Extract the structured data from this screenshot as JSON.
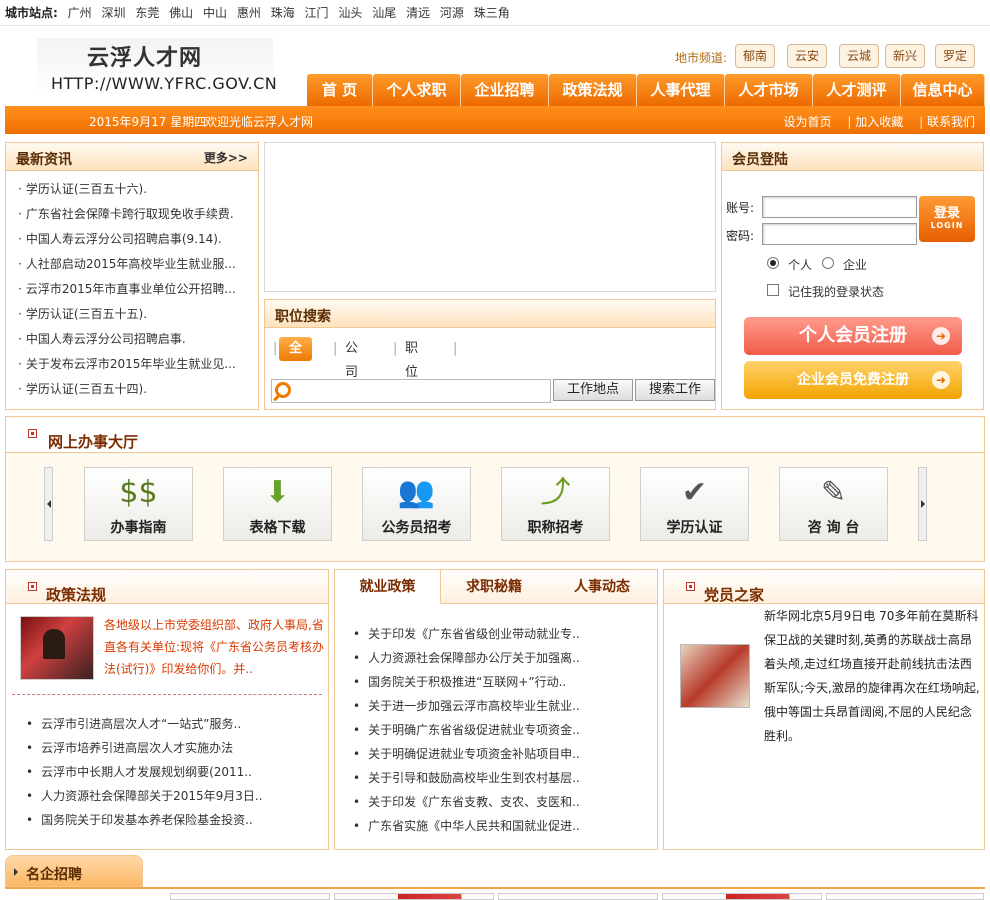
{
  "city_sites": {
    "label": "城市站点:",
    "cities": [
      "广州",
      "深圳",
      "东莞",
      "佛山",
      "中山",
      "惠州",
      "珠海",
      "江门",
      "汕头",
      "汕尾",
      "清远",
      "河源",
      "珠三角"
    ]
  },
  "logo": {
    "name": "云浮人才网",
    "url": "HTTP://WWW.YFRC.GOV.CN"
  },
  "channels": {
    "label": "地市频道:",
    "items": [
      "郁南",
      "云安",
      "云城",
      "新兴",
      "罗定"
    ]
  },
  "nav": [
    "首 页",
    "个人求职",
    "企业招聘",
    "政策法规",
    "人事代理",
    "人才市场",
    "人才测评",
    "信息中心"
  ],
  "welcome_bar": {
    "date": "2015年9月17 星期四",
    "welcome": "欢迎光临云浮人才网",
    "links": [
      "设为首页",
      "加入收藏",
      "联系我们"
    ]
  },
  "news": {
    "title": "最新资讯",
    "more": "更多>>",
    "items": [
      "学历认证(三百五十六).",
      "广东省社会保障卡跨行取现免收手续费.",
      "中国人寿云浮分公司招聘启事(9.14).",
      "人社部启动2015年高校毕业生就业服...",
      "云浮市2015年市直事业单位公开招聘...",
      "学历认证(三百五十五).",
      "中国人寿云浮分公司招聘启事.",
      "关于发布云浮市2015年毕业生就业见...",
      "学历认证(三百五十四)."
    ]
  },
  "job_search": {
    "title": "职位搜索",
    "tabs": [
      "全文",
      "公司名",
      "职位名"
    ],
    "input_value": "",
    "btn_location": "工作地点",
    "btn_search": "搜索工作"
  },
  "login": {
    "title": "会员登陆",
    "account_label": "账号:",
    "password_label": "密码:",
    "login_btn": "登录",
    "login_btn_en": "LOGIN",
    "radio_personal": "个人",
    "radio_company": "企业",
    "remember": "记住我的登录状态",
    "reg_personal": "个人会员注册",
    "reg_company": "企业会员免费注册"
  },
  "hall": {
    "title": "网上办事大厅",
    "tiles": [
      {
        "label": "办事指南",
        "icon": "money-bags-icon"
      },
      {
        "label": "表格下载",
        "icon": "download-icon"
      },
      {
        "label": "公务员招考",
        "icon": "people-icon"
      },
      {
        "label": "职称招考",
        "icon": "climb-icon"
      },
      {
        "label": "学历认证",
        "icon": "certificate-icon"
      },
      {
        "label": "咨 询 台",
        "icon": "pencil-icon"
      }
    ]
  },
  "policy": {
    "title": "政策法规",
    "lead": "各地级以上市党委组织部、政府人事局,省直各有关单位:现将《广东省公务员考核办法(试行)》印发给你们。并..",
    "items": [
      "云浮市引进高层次人才“一站式”服务..",
      "云浮市培养引进高层次人才实施办法",
      "云浮市中长期人才发展规划纲要(2011..",
      "人力资源社会保障部关于2015年9月3日..",
      "国务院关于印发基本养老保险基金投资.."
    ]
  },
  "employment": {
    "tabs": [
      "就业政策",
      "求职秘籍",
      "人事动态"
    ],
    "items": [
      "关于印发《广东省省级创业带动就业专..",
      "人力资源社会保障部办公厅关于加强离..",
      "国务院关于积极推进“互联网+”行动..",
      "关于进一步加强云浮市高校毕业生就业..",
      "关于明确广东省省级促进就业专项资金..",
      "关于明确促进就业专项资金补贴项目申..",
      "关于引导和鼓励高校毕业生到农村基层..",
      "关于印发《广东省支教、支农、支医和..",
      "广东省实施《中华人民共和国就业促进.."
    ]
  },
  "party": {
    "title": "党员之家",
    "text": "新华网北京5月9日电 70多年前在莫斯科保卫战的关键时刻,英勇的苏联战士高昂着头颅,走过红场直接开赴前线抗击法西斯军队;今天,激昂的旋律再次在红场响起,俄中等国士兵昂首阔阅,不屈的人民纪念胜利。"
  },
  "famous": {
    "title": "名企招聘"
  },
  "colors": {
    "accent": "#f07a00",
    "panel_border": "#f2c796",
    "title_red": "#7a2c00"
  }
}
